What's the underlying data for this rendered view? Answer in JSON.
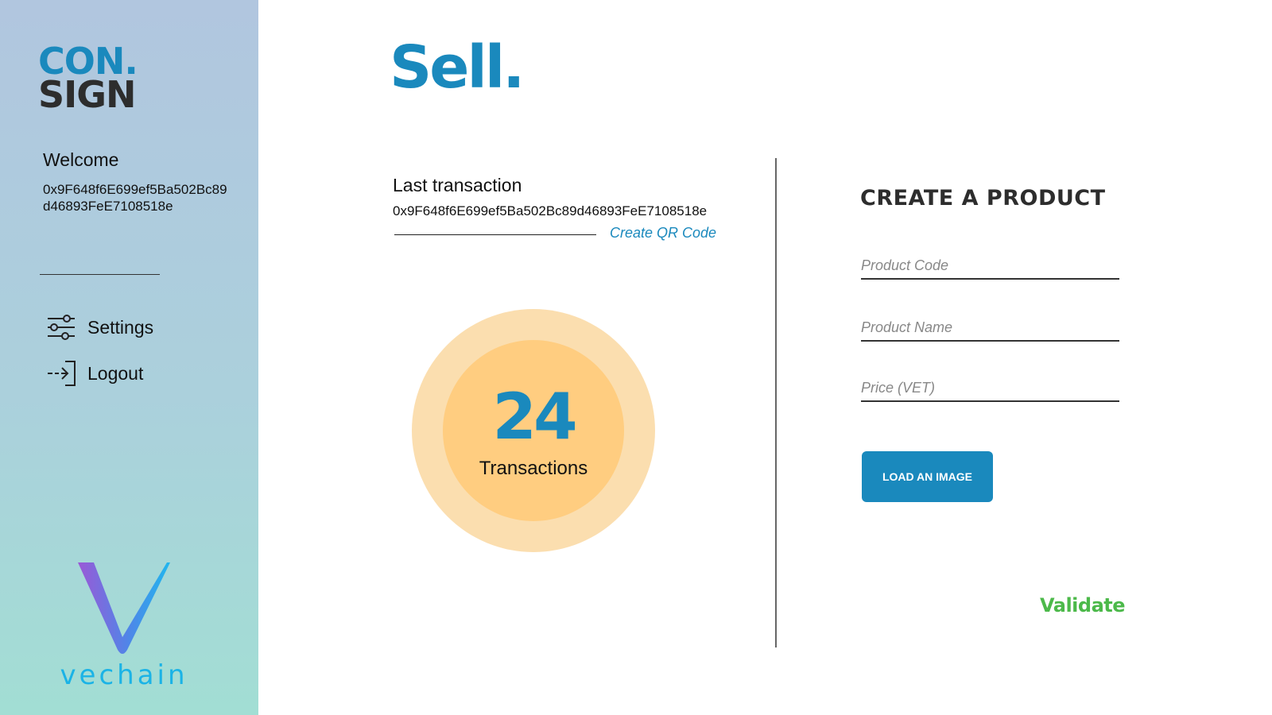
{
  "brand": {
    "logo_top": "CON",
    "logo_dot": ".",
    "logo_bottom": "SIGN",
    "partner_wordmark": "vechain"
  },
  "sidebar": {
    "welcome": "Welcome",
    "address": "0x9F648f6E699ef5Ba502Bc89d46893FeE7108518e",
    "items": [
      {
        "label": "Settings",
        "icon": "sliders-icon"
      },
      {
        "label": "Logout",
        "icon": "logout-icon"
      }
    ]
  },
  "main": {
    "title": "Sell.",
    "last_transaction": {
      "label": "Last transaction",
      "hash": "0x9F648f6E699ef5Ba502Bc89d46893FeE7108518e",
      "qr_link": "Create QR Code"
    },
    "summary": {
      "count": "24",
      "label": "Transactions"
    }
  },
  "create_product": {
    "title": "CREATE A PRODUCT",
    "fields": {
      "code_placeholder": "Product Code",
      "name_placeholder": "Product Name",
      "price_placeholder": "Price (VET)"
    },
    "load_image": "LOAD AN IMAGE",
    "validate": "Validate"
  },
  "colors": {
    "accent": "#1a89bd",
    "success": "#4cb94a",
    "donut_outer": "#fbdeaf",
    "donut_inner": "#ffcd80"
  }
}
